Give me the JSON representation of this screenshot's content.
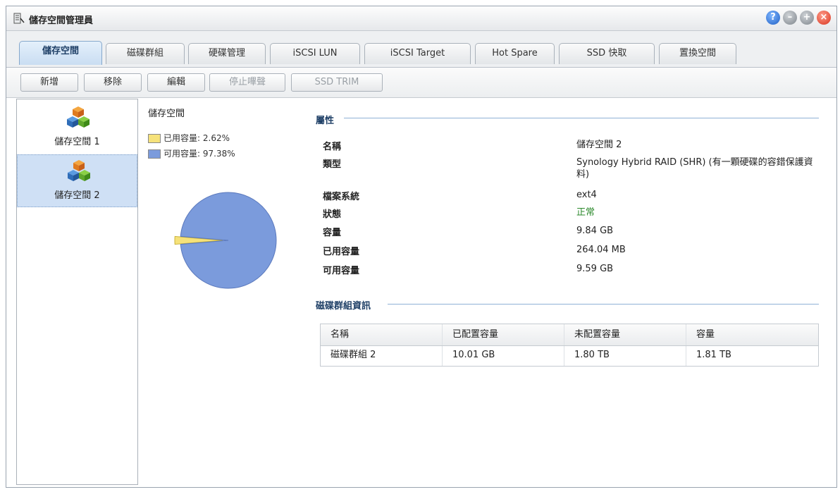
{
  "window": {
    "title": "儲存空間管理員",
    "app_icon": "storage-manager-icon",
    "controls": [
      "help-icon",
      "minimize-icon",
      "maximize-icon",
      "close-icon"
    ]
  },
  "tabs": [
    {
      "label": "儲存空間",
      "active": true
    },
    {
      "label": "磁碟群組",
      "active": false
    },
    {
      "label": "硬碟管理",
      "active": false
    },
    {
      "label": "iSCSI LUN",
      "active": false
    },
    {
      "label": "iSCSI Target",
      "active": false
    },
    {
      "label": "Hot Spare",
      "active": false
    },
    {
      "label": "SSD 快取",
      "active": false
    },
    {
      "label": "置換空間",
      "active": false
    }
  ],
  "toolbar": {
    "add": "新增",
    "remove": "移除",
    "edit": "編輯",
    "stop_beep": "停止嗶聲",
    "ssd_trim": "SSD TRIM"
  },
  "volumes": [
    {
      "label": "儲存空間 1",
      "selected": false
    },
    {
      "label": "儲存空間 2",
      "selected": true
    }
  ],
  "usage": {
    "title": "儲存空間",
    "used_label": "已用容量:",
    "used_pct": "2.62%",
    "free_label": "可用容量:",
    "free_pct": "97.38%",
    "used_color": "#f6e27a",
    "free_color": "#7b9bdc"
  },
  "chart_data": {
    "type": "pie",
    "title": "儲存空間",
    "slices": [
      {
        "name": "已用容量",
        "value": 2.62,
        "color": "#f6e27a"
      },
      {
        "name": "可用容量",
        "value": 97.38,
        "color": "#7b9bdc"
      }
    ]
  },
  "properties": {
    "header": "屬性",
    "rows": [
      {
        "label": "名稱",
        "value": "儲存空間 2"
      },
      {
        "label": "類型",
        "value": "Synology Hybrid RAID (SHR) (有一顆硬碟的容錯保護資料)"
      },
      {
        "label": "檔案系統",
        "value": "ext4"
      },
      {
        "label": "狀態",
        "value": "正常"
      },
      {
        "label": "容量",
        "value": "9.84 GB"
      },
      {
        "label": "已用容量",
        "value": "264.04 MB"
      },
      {
        "label": "可用容量",
        "value": "9.59 GB"
      }
    ]
  },
  "disk_group": {
    "header": "磁碟群組資訊",
    "columns": [
      "名稱",
      "已配置容量",
      "未配置容量",
      "容量"
    ],
    "rows": [
      [
        "磁碟群組 2",
        "10.01 GB",
        "1.80 TB",
        "1.81 TB"
      ]
    ]
  }
}
